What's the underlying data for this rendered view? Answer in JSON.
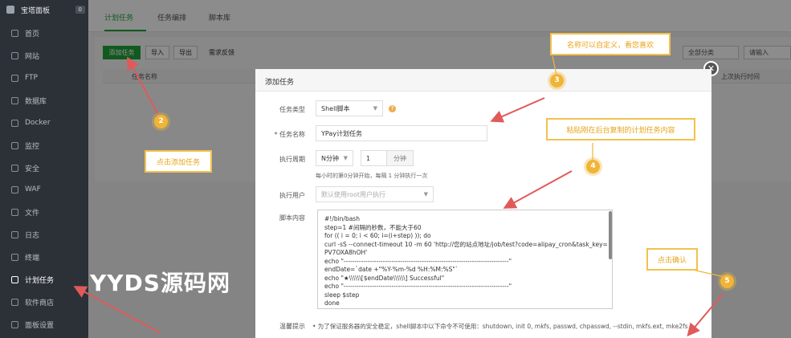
{
  "sidebar": {
    "brand": "宝塔面板",
    "badge": "0",
    "items": [
      {
        "label": "首页"
      },
      {
        "label": "网站"
      },
      {
        "label": "FTP"
      },
      {
        "label": "数据库"
      },
      {
        "label": "Docker"
      },
      {
        "label": "监控"
      },
      {
        "label": "安全"
      },
      {
        "label": "WAF"
      },
      {
        "label": "文件"
      },
      {
        "label": "日志"
      },
      {
        "label": "终端"
      },
      {
        "label": "计划任务"
      },
      {
        "label": "软件商店"
      },
      {
        "label": "面板设置"
      }
    ]
  },
  "tabs": [
    "计划任务",
    "任务编排",
    "脚本库"
  ],
  "toolbar": {
    "add": "添加任务",
    "import": "导入",
    "export": "导出",
    "feedback": "需求反馈",
    "category": "全部分类",
    "search": "请输入"
  },
  "table": {
    "col_name": "任务名称",
    "col_last": "上次执行时间"
  },
  "modal": {
    "title": "添加任务",
    "task_type_label": "任务类型",
    "task_type_value": "Shell脚本",
    "task_name_label": "* 任务名称",
    "task_name_value": "YPay计划任务",
    "period_label": "执行周期",
    "period_unit": "N分钟",
    "period_value": "1",
    "period_suffix": "分钟",
    "period_hint": "每小时的第0分钟开始，每隔 1 分钟执行一次",
    "user_label": "执行用户",
    "user_placeholder": "默认使用root用户执行",
    "script_label": "脚本内容",
    "script_lines": [
      "#!/bin/bash",
      "step=1 #间隔的秒数，不能大于60",
      "for (( i = 0; i < 60; i=(i+step) )); do",
      "    curl -sS --connect-timeout 10 -m 60 'http://您的站点地址/job/test?code=alipay_cron&task_key=",
      "PV7OXA8hOH'",
      "    echo \"----------------------------------------------------------------------------\"",
      "endDate=`date +\"%Y-%m-%d %H:%M:%S\"`",
      "echo \"★\\\\\\\\\\\\[$endDate\\\\\\\\\\\\] Successful\"",
      "echo \"----------------------------------------------------------------------------\"",
      "sleep $step",
      "done"
    ],
    "warn_label": "温馨提示",
    "warn_text": "•  为了保证服务器的安全稳定，shell脚本中以下命令不可使用：shutdown, init 0, mkfs, passwd, chpasswd, --stdin, mkfs.ext, mke2fs"
  },
  "annotations": {
    "c2": "点击添加任务",
    "c3": "名称可以自定义，看您喜欢",
    "c4": "粘贴刚在后台复制的计划任务内容",
    "c5": "点击确认",
    "m2": "2",
    "m3": "3",
    "m4": "4",
    "m5": "5"
  },
  "watermark": "YYDS源码网",
  "colors": {
    "accent": "#20a53a",
    "annotation": "#f0b537",
    "arrow": "#e05a5a"
  }
}
